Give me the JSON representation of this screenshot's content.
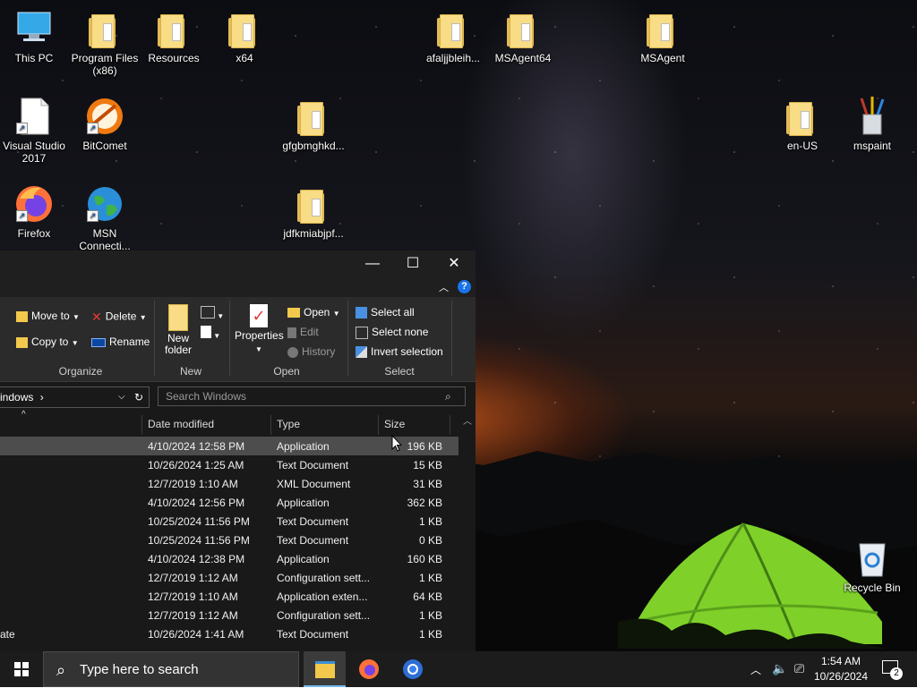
{
  "desktop": {
    "icons": [
      {
        "label": "This PC",
        "type": "pc"
      },
      {
        "label": "Program Files (x86)",
        "type": "folder"
      },
      {
        "label": "Resources",
        "type": "folder"
      },
      {
        "label": "x64",
        "type": "folder"
      },
      {
        "label": "afaljjbleih...",
        "type": "folder"
      },
      {
        "label": "MSAgent64",
        "type": "folder"
      },
      {
        "label": "MSAgent",
        "type": "folder"
      },
      {
        "label": "Visual Studio 2017",
        "type": "file-shortcut"
      },
      {
        "label": "BitComet",
        "type": "bitcomet"
      },
      {
        "label": "gfgbmghkd...",
        "type": "folder"
      },
      {
        "label": "en-US",
        "type": "folder"
      },
      {
        "label": "mspaint",
        "type": "mspaint"
      },
      {
        "label": "Firefox",
        "type": "firefox"
      },
      {
        "label": "MSN Connecti...",
        "type": "msn"
      },
      {
        "label": "jdfkmiabjpf...",
        "type": "folder"
      },
      {
        "label": "Recycle Bin",
        "type": "recycle"
      }
    ]
  },
  "explorer": {
    "window_controls": {
      "minimize": "—",
      "maximize": "☐",
      "close": "✕"
    },
    "help": "?",
    "ribbon": {
      "move_to": "Move to",
      "copy_to": "Copy to",
      "delete": "Delete",
      "rename": "Rename",
      "new_folder": "New folder",
      "properties": "Properties",
      "open": "Open",
      "edit": "Edit",
      "history": "History",
      "select_all": "Select all",
      "select_none": "Select none",
      "invert_selection": "Invert selection",
      "groups": {
        "organize": "Organize",
        "new": "New",
        "open": "Open",
        "select": "Select"
      }
    },
    "address": {
      "path": "indows",
      "separator": "›"
    },
    "search": {
      "placeholder": "Search Windows"
    },
    "columns": {
      "date": "Date modified",
      "type": "Type",
      "size": "Size"
    },
    "rows": [
      {
        "name": "",
        "date": "4/10/2024 12:58 PM",
        "type": "Application",
        "size": "196 KB",
        "selected": true
      },
      {
        "name": "",
        "date": "10/26/2024 1:25 AM",
        "type": "Text Document",
        "size": "15 KB"
      },
      {
        "name": "",
        "date": "12/7/2019 1:10 AM",
        "type": "XML Document",
        "size": "31 KB"
      },
      {
        "name": "",
        "date": "4/10/2024 12:56 PM",
        "type": "Application",
        "size": "362 KB"
      },
      {
        "name": "",
        "date": "10/25/2024 11:56 PM",
        "type": "Text Document",
        "size": "1 KB"
      },
      {
        "name": "",
        "date": "10/25/2024 11:56 PM",
        "type": "Text Document",
        "size": "0 KB"
      },
      {
        "name": "",
        "date": "4/10/2024 12:38 PM",
        "type": "Application",
        "size": "160 KB"
      },
      {
        "name": "",
        "date": "12/7/2019 1:12 AM",
        "type": "Configuration sett...",
        "size": "1 KB"
      },
      {
        "name": "",
        "date": "12/7/2019 1:10 AM",
        "type": "Application exten...",
        "size": "64 KB"
      },
      {
        "name": "",
        "date": "12/7/2019 1:12 AM",
        "type": "Configuration sett...",
        "size": "1 KB"
      },
      {
        "name": "ate",
        "date": "10/26/2024 1:41 AM",
        "type": "Text Document",
        "size": "1 KB"
      }
    ]
  },
  "taskbar": {
    "search_placeholder": "Type here to search",
    "time": "1:54 AM",
    "date": "10/26/2024",
    "notification_count": "2"
  },
  "colors": {
    "selection": "#4d4d4d",
    "accent": "#0078d7",
    "taskbar": "#1c1c1c"
  }
}
